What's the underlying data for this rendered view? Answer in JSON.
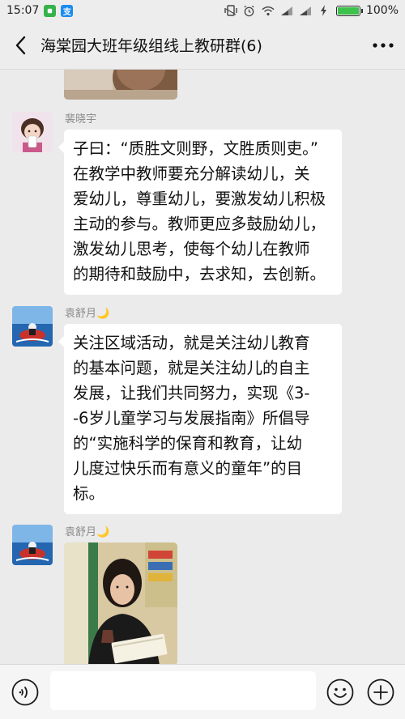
{
  "status_bar": {
    "time": "15:07",
    "app_icon_1": "chat-app",
    "app_icon_2_label": "支",
    "icons": [
      "vibrate-icon",
      "alarm-icon",
      "wifi-icon",
      "signal-icon",
      "signal-icon",
      "charging-icon"
    ],
    "battery_percent": "100%",
    "battery_level": 1.0
  },
  "header": {
    "title": "海棠园大班年级组线上教研群(6)",
    "back_icon": "chevron-left-icon",
    "more_icon": "more-dots-icon"
  },
  "messages": [
    {
      "type": "image",
      "sender": "",
      "image": "partial-photo"
    },
    {
      "type": "text",
      "sender": "裴晓宇",
      "avatar": "girl-with-cup-avatar",
      "lines": [
        "子曰：“质胜文则野，文胜质则吏。”",
        "在教学中教师要充分解读幼儿，关",
        "爱幼儿，尊重幼儿，要激发幼儿积极",
        "主动的参与。教师更应多鼓励幼儿，",
        "激发幼儿思考，使每个幼儿在教师",
        "的期待和鼓励中，去求知，去创新。"
      ]
    },
    {
      "type": "text",
      "sender": "袁舒月🌙",
      "avatar": "sea-motorbike-avatar",
      "lines": [
        "关注区域活动，就是关注幼儿教育",
        "的基本问题，就是关注幼儿的自主",
        "发展，让我们共同努力，实现《3-",
        "-6岁儿童学习与发展指南》所倡导",
        "的“实施科学的保育和教育，让幼",
        "儿度过快乐而有意义的童年”的目",
        "标。"
      ]
    },
    {
      "type": "image",
      "sender": "袁舒月🌙",
      "avatar": "sea-motorbike-avatar",
      "image": "woman-reading-book-photo"
    }
  ],
  "input_bar": {
    "voice_icon": "voice-icon",
    "placeholder": "",
    "emoji_icon": "emoji-icon",
    "plus_icon": "plus-icon"
  }
}
